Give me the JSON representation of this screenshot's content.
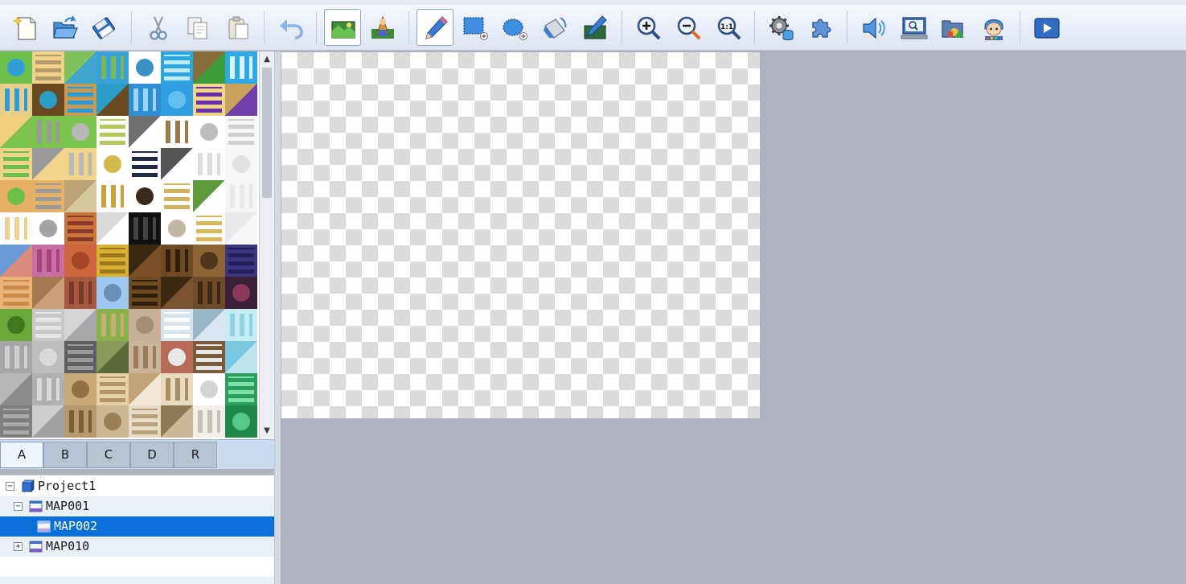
{
  "toolbar": {
    "buttons": [
      {
        "id": "new-project",
        "icon": "new-document-icon"
      },
      {
        "id": "open-project",
        "icon": "open-folder-icon"
      },
      {
        "id": "save-project",
        "icon": "save-disk-icon"
      },
      {
        "id": "cut",
        "icon": "scissors-icon"
      },
      {
        "id": "copy",
        "icon": "copy-icon"
      },
      {
        "id": "paste",
        "icon": "paste-icon"
      },
      {
        "id": "undo",
        "icon": "undo-icon"
      },
      {
        "id": "map-mode",
        "icon": "map-mode-icon",
        "active": true
      },
      {
        "id": "event-mode",
        "icon": "event-mode-icon"
      },
      {
        "id": "pencil",
        "icon": "pencil-icon",
        "active": true
      },
      {
        "id": "rectangle",
        "icon": "rectangle-tool-icon"
      },
      {
        "id": "ellipse",
        "icon": "ellipse-tool-icon"
      },
      {
        "id": "flood-fill",
        "icon": "fill-tool-icon"
      },
      {
        "id": "shadow-pen",
        "icon": "shadow-pen-icon"
      },
      {
        "id": "zoom-in",
        "icon": "zoom-in-icon"
      },
      {
        "id": "zoom-out",
        "icon": "zoom-out-icon"
      },
      {
        "id": "actual-size",
        "icon": "zoom-actual-icon",
        "label": "1:1"
      },
      {
        "id": "database",
        "icon": "database-gear-icon"
      },
      {
        "id": "plugin-manager",
        "icon": "plugin-puzzle-icon"
      },
      {
        "id": "sound-test",
        "icon": "speaker-icon"
      },
      {
        "id": "event-searcher",
        "icon": "monitor-search-icon"
      },
      {
        "id": "resource-manager",
        "icon": "resource-folder-icon"
      },
      {
        "id": "character-generator",
        "icon": "character-face-icon"
      },
      {
        "id": "playtest",
        "icon": "play-icon"
      }
    ]
  },
  "tileset_tabs": [
    "A",
    "B",
    "C",
    "D",
    "R"
  ],
  "selected_tab": "A",
  "map_tree": [
    {
      "label": "Project1",
      "level": 0,
      "expander": "−",
      "kind": "project"
    },
    {
      "label": "MAP001",
      "level": 1,
      "expander": "−",
      "kind": "map"
    },
    {
      "label": "MAP002",
      "level": 2,
      "expander": "",
      "kind": "map",
      "selected": true
    },
    {
      "label": "MAP010",
      "level": 1,
      "expander": "+",
      "kind": "map"
    }
  ],
  "colors": {
    "accent": "#0a6fd8",
    "workspace": "#afb3bf",
    "toolbar": "#eaeff8"
  }
}
